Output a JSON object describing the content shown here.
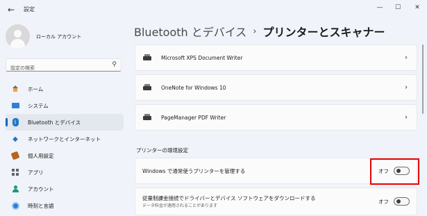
{
  "window": {
    "title": "設定",
    "back": "←",
    "minimize": "—",
    "maximize": "☐",
    "close": "✕"
  },
  "profile": {
    "name": "ローカル アカウント"
  },
  "search": {
    "placeholder": "設定の検索",
    "icon": "search-icon"
  },
  "sidebar": {
    "items": [
      {
        "label": "ホーム",
        "icon": "home-icon",
        "active": false
      },
      {
        "label": "システム",
        "icon": "system-icon",
        "active": false
      },
      {
        "label": "Bluetooth とデバイス",
        "icon": "bluetooth-icon",
        "active": true
      },
      {
        "label": "ネットワークとインターネット",
        "icon": "network-icon",
        "active": false
      },
      {
        "label": "個人用設定",
        "icon": "personalization-icon",
        "active": false
      },
      {
        "label": "アプリ",
        "icon": "apps-icon",
        "active": false
      },
      {
        "label": "アカウント",
        "icon": "account-icon",
        "active": false
      },
      {
        "label": "時刻と言語",
        "icon": "time-language-icon",
        "active": false
      }
    ]
  },
  "breadcrumb": {
    "parent": "Bluetooth とデバイス",
    "separator": "›",
    "current": "プリンターとスキャナー"
  },
  "printers": [
    {
      "name": "Microsoft XPS Document Writer",
      "icon": "printer-icon"
    },
    {
      "name": "OneNote for Windows 10",
      "icon": "printer-icon"
    },
    {
      "name": "PageManager PDF Writer",
      "icon": "printer-icon"
    }
  ],
  "preferences": {
    "heading": "プリンターの環境設定",
    "settings": [
      {
        "label": "Windows で通常使うプリンターを管理する",
        "sublabel": "",
        "state": "オフ",
        "on": false
      },
      {
        "label": "従量制課金接続でドライバーとデバイス ソフトウェアをダウンロードする",
        "sublabel": "データ料金が適用されることがあります",
        "state": "オフ",
        "on": false
      }
    ]
  },
  "colors": {
    "accent": "#0067c0",
    "highlight": "#e60000",
    "background": "#f0f3f9",
    "card": "#fbfbfb"
  }
}
